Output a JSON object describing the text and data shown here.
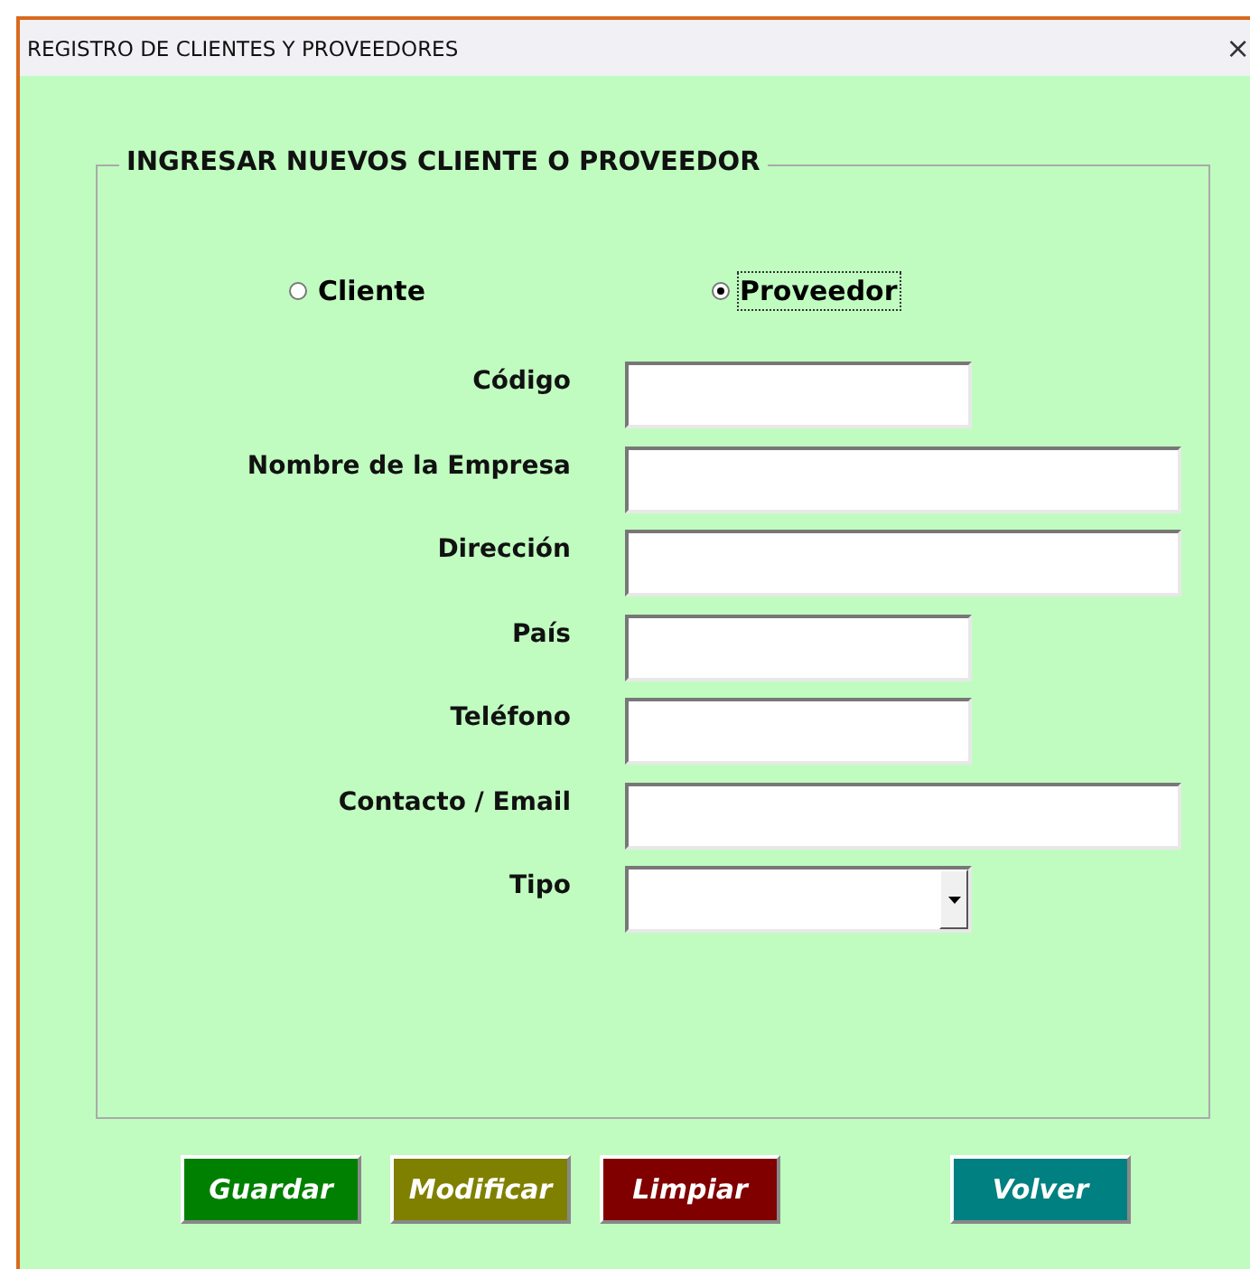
{
  "window": {
    "title": "REGISTRO DE CLIENTES Y PROVEEDORES",
    "close": "×"
  },
  "frame": {
    "title": "INGRESAR NUEVOS CLIENTE O PROVEEDOR"
  },
  "radios": [
    {
      "label": "Cliente",
      "selected": false
    },
    {
      "label": "Proveedor",
      "selected": true
    }
  ],
  "fields": [
    {
      "label": "Código",
      "kind": "short"
    },
    {
      "label": "Nombre de la Empresa",
      "kind": "long"
    },
    {
      "label": "Dirección",
      "kind": "long"
    },
    {
      "label": "País",
      "kind": "short"
    },
    {
      "label": "Teléfono",
      "kind": "short"
    },
    {
      "label": "Contacto / Email",
      "kind": "long"
    },
    {
      "label": "Tipo",
      "kind": "dropdown"
    }
  ],
  "buttons": [
    {
      "label": "Guardar",
      "color": "#008000"
    },
    {
      "label": "Modificar",
      "color": "#808000"
    },
    {
      "label": "Limpiar",
      "color": "#800000"
    },
    {
      "label": "Volver",
      "color": "#008080"
    }
  ]
}
